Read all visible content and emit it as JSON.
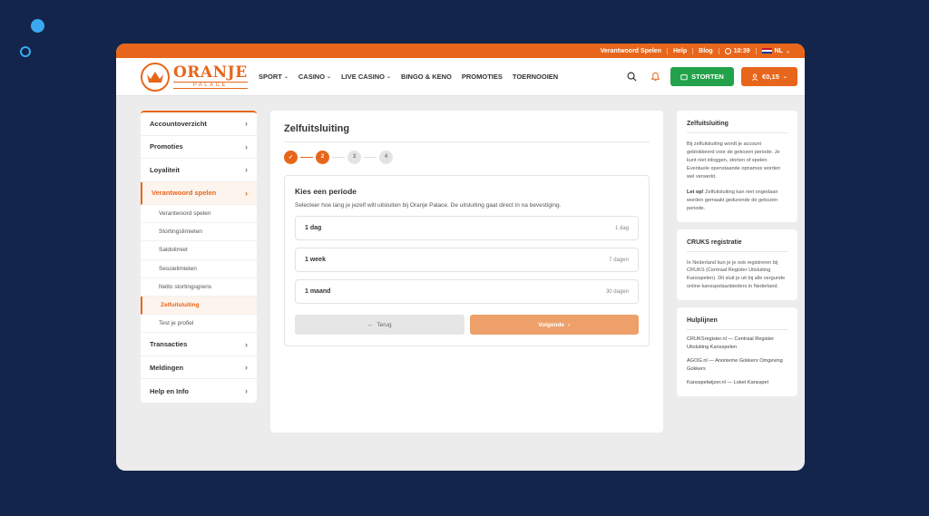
{
  "topbar": {
    "responsible": "Verantwoord Spelen",
    "help": "Help",
    "blog": "Blog",
    "time": "10:39",
    "lang": "NL"
  },
  "brand": {
    "name": "ORANJE",
    "sub": "PALACE",
    "color": "#e8661b"
  },
  "nav": [
    {
      "label": "SPORT",
      "has_dropdown": true
    },
    {
      "label": "CASINO",
      "has_dropdown": true
    },
    {
      "label": "LIVE CASINO",
      "has_dropdown": true
    },
    {
      "label": "BINGO & KENO",
      "has_dropdown": false
    },
    {
      "label": "PROMOTIES",
      "has_dropdown": false
    },
    {
      "label": "TOERNOOIEN",
      "has_dropdown": false
    }
  ],
  "header": {
    "deposit_label": "STORTEN",
    "balance": "€0,15"
  },
  "sidebar": {
    "items": [
      {
        "label": "Accountoverzicht"
      },
      {
        "label": "Promoties"
      },
      {
        "label": "Loyaliteit"
      },
      {
        "label": "Verantwoord spelen"
      },
      {
        "label": "Transacties"
      },
      {
        "label": "Meldingen"
      },
      {
        "label": "Help en Info"
      }
    ],
    "subitems": [
      {
        "label": "Verantwoord spelen"
      },
      {
        "label": "Stortingslimieten"
      },
      {
        "label": "Saldolimiet"
      },
      {
        "label": "Sessielimieten"
      },
      {
        "label": "Netto stortingsgrens"
      },
      {
        "label": "Zelfuitsluiting"
      },
      {
        "label": "Test je profiel"
      }
    ]
  },
  "main": {
    "title": "Zelfuitsluiting",
    "steps": [
      "✓",
      "2",
      "3",
      "4"
    ],
    "card_title": "Kies een periode",
    "card_desc": "Selecteer hoe lang je jezelf wilt uitsluiten bij Oranje Palace. De uitsluiting gaat direct in na bevestiging.",
    "options": [
      {
        "label": "1 dag",
        "duration": "1 dag"
      },
      {
        "label": "1 week",
        "duration": "7 dagen"
      },
      {
        "label": "1 maand",
        "duration": "30 dagen"
      }
    ],
    "back_label": "Terug",
    "next_label": "Volgende"
  },
  "info": {
    "zelf_title": "Zelfuitsluiting",
    "zelf_text": "Bij zelfuitsluiting wordt je account geblokkeerd voor de gekozen periode. Je kunt niet inloggen, storten of spelen. Eventuele openstaande opnames worden wel verwerkt.",
    "zelf_warn_bold": "Let op!",
    "zelf_warn": " Zelfuitsluiting kan niet ongedaan worden gemaakt gedurende de gekozen periode.",
    "cruks_title": "CRUKS registratie",
    "cruks_text": "In Nederland kun je je ook registreren bij CRUKS (Centraal Register Uitsluiting Kansspelen). Dit sluit je uit bij alle vergunde online kansspelaanbieders in Nederland.",
    "help_title": "Hulplijnen",
    "help_links": [
      {
        "label": "CRUKSregister.nl — Centraal Register Uitsluiting Kansspelen"
      },
      {
        "label": "AGOG.nl — Anonieme Gokkers Omgeving Gokkers"
      },
      {
        "label": "Kansspelwijzer.nl — Loket Kansspel"
      }
    ]
  }
}
